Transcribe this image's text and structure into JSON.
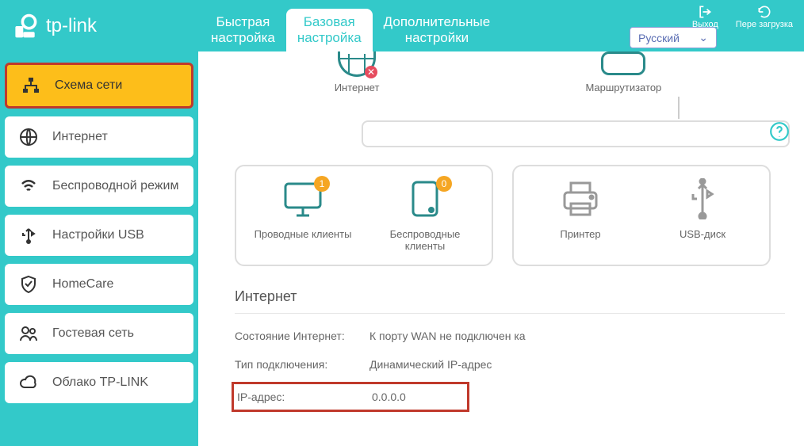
{
  "brand": "tp-link",
  "language_selected": "Русский",
  "header_buttons": {
    "logout": "Выход",
    "reload": "Пере загрузка"
  },
  "tabs": {
    "quick": "Быстрая\nнастройка",
    "basic": "Базовая\nнастройка",
    "advanced": "Дополнительные\nнастройки"
  },
  "sidebar": {
    "items": [
      {
        "label": "Схема сети"
      },
      {
        "label": "Интернет"
      },
      {
        "label": "Беспроводной режим"
      },
      {
        "label": "Настройки USB"
      },
      {
        "label": "HomeCare"
      },
      {
        "label": "Гостевая сеть"
      },
      {
        "label": "Облако TP-LINK"
      }
    ]
  },
  "topology": {
    "internet": "Интернет",
    "router": "Маршрутизатор",
    "wired_clients": "Проводные клиенты",
    "wireless_clients": "Беспроводные клиенты",
    "printer": "Принтер",
    "usb_disk": "USB-диск",
    "wired_count": "1",
    "wireless_count": "0"
  },
  "section": {
    "title": "Интернет",
    "rows": [
      {
        "label": "Состояние Интернет:",
        "value": "К порту WAN не подключен ка"
      },
      {
        "label": "Тип подключения:",
        "value": "Динамический IP-адрес"
      },
      {
        "label": "IP-адрес:",
        "value": "0.0.0.0"
      }
    ]
  }
}
